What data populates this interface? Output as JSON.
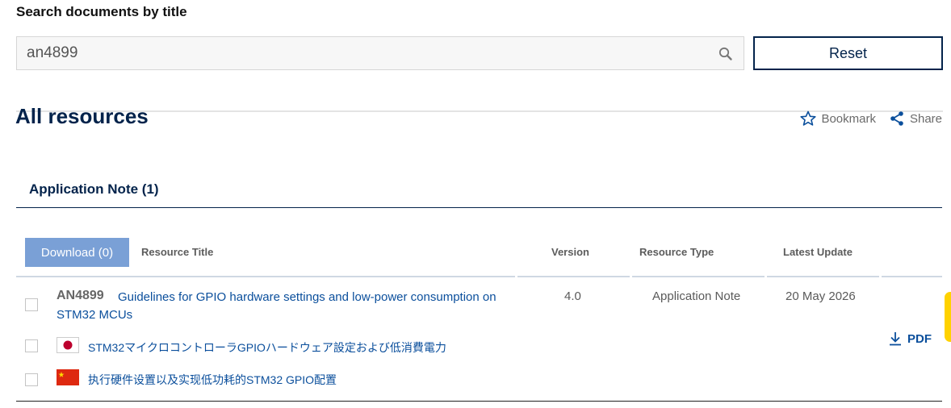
{
  "search": {
    "heading": "Search documents by title",
    "value": "an4899",
    "reset_label": "Reset"
  },
  "page": {
    "title": "All resources",
    "bookmark_label": "Bookmark",
    "share_label": "Share"
  },
  "section": {
    "title": "Application Note (1)"
  },
  "table": {
    "download_button": "Download (0)",
    "columns": {
      "title": "Resource Title",
      "version": "Version",
      "type": "Resource Type",
      "updated": "Latest Update"
    },
    "rows": [
      {
        "id": "AN4899",
        "title": "Guidelines for GPIO hardware settings and low-power consumption on STM32 MCUs",
        "version": "4.0",
        "type": "Application Note",
        "updated": "20 May 2026",
        "download_label": "PDF",
        "translations": [
          {
            "lang_icon": "flag-japan-icon",
            "title": "STM32マイクロコントローラGPIOハードウェア設定および低消費電力"
          },
          {
            "lang_icon": "flag-china-icon",
            "title": "执行硬件设置以及实现低功耗的STM32 GPIO配置"
          }
        ]
      }
    ]
  },
  "colors": {
    "brand_navy": "#03234b",
    "link_blue": "#0b4f9c",
    "download_button_bg": "#7aa0d6",
    "accent_yellow": "#ffd200"
  }
}
